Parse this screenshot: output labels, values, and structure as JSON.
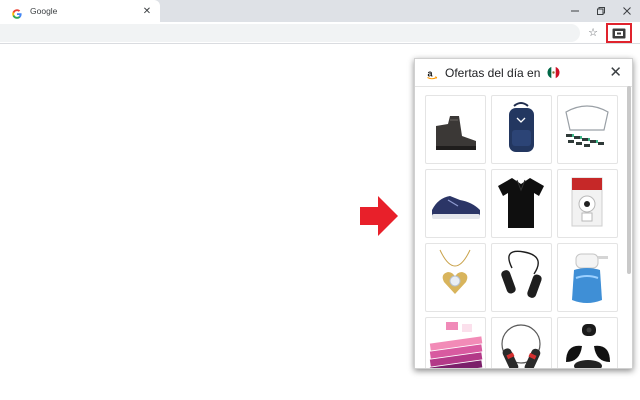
{
  "browser": {
    "tab": {
      "title": "Google",
      "favicon": "google-g-icon",
      "close_icon": "close-icon"
    },
    "window_controls": [
      "minimize-icon",
      "restore-icon",
      "close-icon"
    ],
    "toolbar": {
      "bookmark_icon": "star-icon",
      "extension_icon": "deals-extension-icon"
    }
  },
  "popup": {
    "logo": "amazon-logo-icon",
    "title": "Ofertas del día en",
    "flag": "mexico-flag-icon",
    "close_icon": "close-icon",
    "products": [
      "boot",
      "backpack",
      "glasses-set",
      "sneaker",
      "polo-shirt",
      "security-camera",
      "heart-pendant",
      "jump-rope",
      "water-pump",
      "resistance-bands",
      "weighted-jump-rope",
      "wireless-earbuds"
    ]
  },
  "colors": {
    "accent_red": "#e0232d",
    "amazon_orange": "#ff9900",
    "tabstrip_bg": "#dee1e6"
  }
}
